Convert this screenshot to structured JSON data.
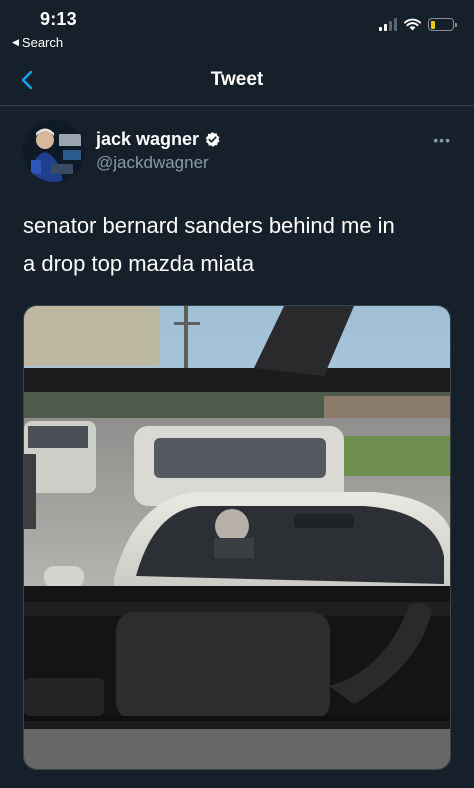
{
  "status_bar": {
    "time": "9:13",
    "back_app_label": "Search",
    "battery_level": 0.22,
    "battery_color": "#f5c518"
  },
  "nav": {
    "title": "Tweet",
    "back_icon": "chevron-left-icon",
    "accent_color": "#1da1f2"
  },
  "tweet": {
    "author_name": "jack wagner",
    "author_handle": "@jackdwagner",
    "verified": true,
    "text_line_1": "senator bernard sanders behind me in",
    "text_line_2": "a drop top mazda miata",
    "more_icon": "ellipsis-icon",
    "media_icon": "photo"
  }
}
